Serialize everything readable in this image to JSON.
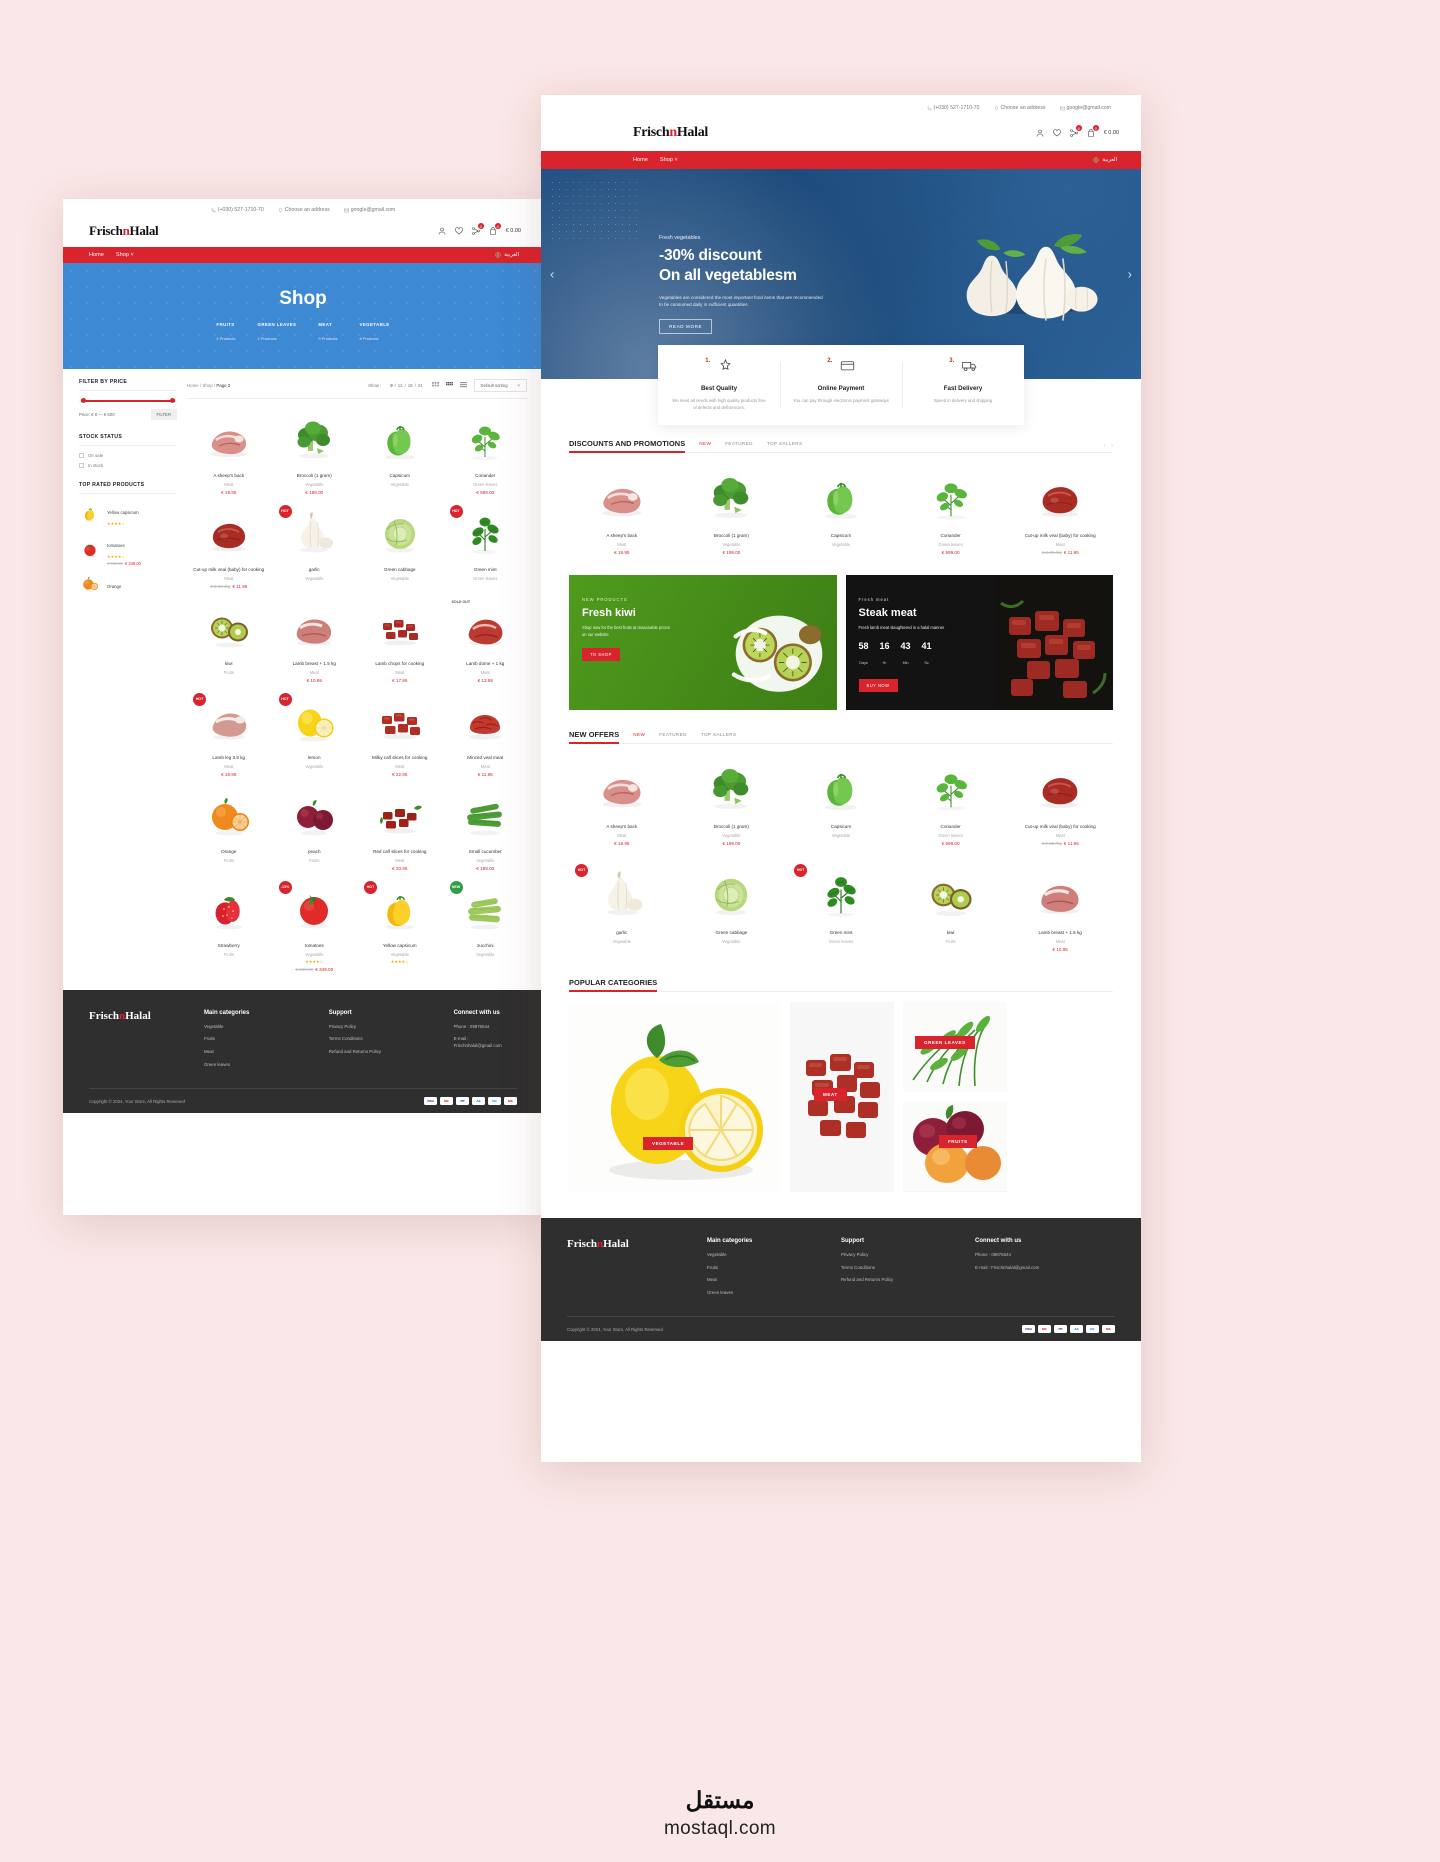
{
  "brand": {
    "part1": "Frisch",
    "accent": "n",
    "part2": "Halal"
  },
  "colors": {
    "accent": "#d9232d",
    "hero_blue": "#1e4d80",
    "shop_blue": "#3d89d4",
    "footer": "#2f2f2f"
  },
  "topbar": {
    "phone": "(+030) 527-1710-70",
    "address": "Choose an address",
    "email": "google@gmail.com"
  },
  "header": {
    "cart_total": "€ 0.00",
    "wishlist_count": "0",
    "cart_count": "0",
    "compare_count": "0"
  },
  "nav": {
    "home": "Home",
    "shop": "Shop",
    "lang": "العربية"
  },
  "hero": {
    "eyebrow": "Fresh vegetables",
    "line1": "-30% discount",
    "line2": "On all vegetablesm",
    "sub": "Vegetables are considered the most important food items that are recommended to be consumed daily in sufficient quantities",
    "cta": "READ MORE"
  },
  "features": [
    {
      "num": "1.",
      "icon": "quality-icon",
      "title": "Best Quality",
      "text": "We meet all needs with high quality products free of defects and deficiencies."
    },
    {
      "num": "2.",
      "icon": "payment-icon",
      "title": "Online Payment",
      "text": "You can pay through electronic payment gateways"
    },
    {
      "num": "3.",
      "icon": "delivery-icon",
      "title": "Fast Delivery",
      "text": "Speed in delivery and shipping"
    }
  ],
  "sections": {
    "discounts": {
      "title": "DISCOUNTS AND PROMOTIONS",
      "tabs": [
        "NEW",
        "FEATURED",
        "TOP SALLERS"
      ],
      "active_tab": "NEW"
    },
    "newoffers": {
      "title": "NEW OFFERS",
      "tabs": [
        "NEW",
        "FEATURED",
        "TOP SALLERS"
      ],
      "active_tab": "NEW"
    },
    "popular": {
      "title": "POPULAR CATEGORIES"
    }
  },
  "products_discounts": [
    {
      "name": "A sheep's back",
      "cat": "Meat",
      "price": "€ 19.95",
      "old": "",
      "tag": "",
      "img": "lamb-ribs"
    },
    {
      "name": "Broccoli (1 gram)",
      "cat": "Vegetable",
      "price": "€ 199.00",
      "old": "",
      "tag": "",
      "img": "broccoli"
    },
    {
      "name": "Capsicum",
      "cat": "Vegetable",
      "price": "",
      "old": "",
      "tag": "",
      "img": "capsicum"
    },
    {
      "name": "Coriander",
      "cat": "Green leaves",
      "price": "€ 599.00",
      "old": "",
      "tag": "",
      "img": "coriander"
    },
    {
      "name": "Cut-up milk veal (baby) for cooking",
      "cat": "Meat",
      "price": "€ 11.95",
      "old": "€ 3.98 /kg",
      "tag": "",
      "img": "veal-steak"
    }
  ],
  "products_newoffers_row1": [
    {
      "name": "A sheep's back",
      "cat": "Meat",
      "price": "€ 19.95",
      "old": "",
      "tag": "",
      "img": "lamb-ribs"
    },
    {
      "name": "Broccoli (1 gram)",
      "cat": "Vegetable",
      "price": "€ 199.00",
      "old": "",
      "tag": "",
      "img": "broccoli"
    },
    {
      "name": "Capsicum",
      "cat": "Vegetable",
      "price": "",
      "old": "",
      "tag": "",
      "img": "capsicum"
    },
    {
      "name": "Coriander",
      "cat": "Green leaves",
      "price": "€ 599.00",
      "old": "",
      "tag": "",
      "img": "coriander"
    },
    {
      "name": "Cut-up milk veal (baby) for cooking",
      "cat": "Meat",
      "price": "€ 11.95",
      "old": "€ 3.98 /kg",
      "tag": "",
      "img": "veal-steak"
    }
  ],
  "products_newoffers_row2": [
    {
      "name": "garlic",
      "cat": "Vegetable",
      "price": "",
      "old": "",
      "tag": "HOT",
      "img": "garlic"
    },
    {
      "name": "Green cabbage",
      "cat": "Vegetable",
      "price": "",
      "old": "",
      "tag": "",
      "img": "cabbage"
    },
    {
      "name": "Green mint",
      "cat": "Green leaves",
      "price": "",
      "old": "",
      "tag": "HOT",
      "img": "mint"
    },
    {
      "name": "kiwi",
      "cat": "Fruits",
      "price": "",
      "old": "",
      "tag": "",
      "img": "kiwi"
    },
    {
      "name": "Lamb breast + 1.5 kg",
      "cat": "Meat",
      "price": "€ 10.95",
      "old": "",
      "tag": "",
      "img": "lamb-breast"
    }
  ],
  "promo_left": {
    "eyebrow": "NEW PRODUCTS",
    "title": "Fresh kiwi",
    "text": "Shop now for the best fruits at reasonable prices on our website",
    "cta": "TO SHOP"
  },
  "promo_right": {
    "eyebrow": "Fresh meat",
    "title": "Steak meat",
    "text": "Fresh lamb meat slaughtered in a halal manner",
    "countdown": [
      {
        "value": "58",
        "unit": "Days"
      },
      {
        "value": "16",
        "unit": "Hr"
      },
      {
        "value": "43",
        "unit": "Min"
      },
      {
        "value": "41",
        "unit": "Sc"
      }
    ],
    "cta": "BUY NOW"
  },
  "categories": [
    {
      "label": "VEGETABLE",
      "img": "lemons"
    },
    {
      "label": "MEAT",
      "img": "diced-meat"
    },
    {
      "label": "GREEN LEAVES",
      "img": "dill"
    },
    {
      "label": "FRUITS",
      "img": "plums-peach"
    }
  ],
  "footer": {
    "cols": [
      {
        "title": "Main categories",
        "links": [
          "Vegetable",
          "Fruits",
          "Meat",
          "Green leaves"
        ]
      },
      {
        "title": "Support",
        "links": [
          "Privacy Policy",
          "Terms Conditions",
          "Refund and Returns Policy"
        ]
      }
    ],
    "connect_title": "Connect with us",
    "phone": "Phone : 09876544",
    "email": "E-mail : Frischnhalal@gmail.com",
    "copyright": "Copyright © 2024, Your Store, All Rights Reserved",
    "payments": [
      "VISA",
      "MC",
      "PP",
      "AE",
      "DC",
      "MA"
    ]
  },
  "shop": {
    "page_title": "Shop",
    "categories": [
      {
        "name": "FRUITS",
        "count": "4 Products"
      },
      {
        "name": "GREEN LEAVES",
        "count": "2 Products"
      },
      {
        "name": "MEAT",
        "count": "9 Products"
      },
      {
        "name": "VEGETABLE",
        "count": "8 Products"
      }
    ],
    "sidebar": {
      "filter_price_title": "FILTER BY PRICE",
      "price_label": "Price: € 0 — € 600",
      "filter_button": "FILTER",
      "stock_title": "STOCK STATUS",
      "stock_options": [
        "On sale",
        "In stock"
      ],
      "top_rated_title": "TOP RATED PRODUCTS",
      "top_rated": [
        {
          "name": "Yellow capsicum",
          "stars": "★★★★☆",
          "price": "",
          "old": "",
          "img": "yellow-pepper"
        },
        {
          "name": "tomatoes",
          "stars": "★★★★☆",
          "price": "€ 349.00",
          "old": "€ 999.00",
          "img": "tomato"
        },
        {
          "name": "Orange",
          "stars": "",
          "price": "",
          "old": "",
          "img": "orange"
        }
      ]
    },
    "breadcrumb": {
      "home": "Home",
      "shop": "Shop",
      "page": "Page 2"
    },
    "show_label": "Show :",
    "show_options": [
      "9",
      "12",
      "18",
      "24"
    ],
    "show_active": "9",
    "sort_label": "Default sorting",
    "products": [
      {
        "name": "A sheep's back",
        "cat": "Meat",
        "price": "€ 19.95",
        "old": "",
        "tag": "",
        "img": "lamb-ribs"
      },
      {
        "name": "Broccoli (1 gram)",
        "cat": "Vegetable",
        "price": "€ 199.00",
        "old": "",
        "tag": "",
        "img": "broccoli"
      },
      {
        "name": "Capsicum",
        "cat": "Vegetable",
        "price": "",
        "old": "",
        "tag": "",
        "img": "capsicum"
      },
      {
        "name": "Coriander",
        "cat": "Green leaves",
        "price": "€ 599.00",
        "old": "",
        "tag": "",
        "img": "coriander"
      },
      {
        "name": "Cut-up milk veal (baby) for cooking",
        "cat": "Meat",
        "price": "€ 11.95",
        "old": "€ 3.98 /kg",
        "tag": "",
        "img": "veal-steak"
      },
      {
        "name": "garlic",
        "cat": "Vegetable",
        "price": "",
        "old": "",
        "tag": "HOT",
        "img": "garlic"
      },
      {
        "name": "Green cabbage",
        "cat": "Vegetable",
        "price": "",
        "old": "",
        "tag": "",
        "img": "cabbage"
      },
      {
        "name": "Green mint",
        "cat": "Green leaves",
        "price": "",
        "old": "",
        "tag": "HOT",
        "img": "mint"
      },
      {
        "name": "kiwi",
        "cat": "Fruits",
        "price": "",
        "old": "",
        "tag": "",
        "img": "kiwi"
      },
      {
        "name": "Lamb breast + 1.5 kg",
        "cat": "Meat",
        "price": "€ 10.95",
        "old": "",
        "tag": "",
        "img": "lamb-breast"
      },
      {
        "name": "Lamb chops for cooking",
        "cat": "Meat",
        "price": "€ 17.95",
        "old": "",
        "tag": "",
        "img": "lamb-chops"
      },
      {
        "name": "Lamb dome + 1 kg",
        "cat": "Meat",
        "price": "€ 13.95",
        "old": "",
        "tag": "SOLD OUT",
        "img": "lamb-dome"
      },
      {
        "name": "Lamb leg 3.5 kg",
        "cat": "Meat",
        "price": "€ 18.95",
        "old": "",
        "tag": "HOT",
        "img": "lamb-leg"
      },
      {
        "name": "lemon",
        "cat": "Vegetable",
        "price": "",
        "old": "",
        "tag": "HOT",
        "img": "lemon"
      },
      {
        "name": "Milky calf slices for cooking",
        "cat": "Meat",
        "price": "€ 22.95",
        "old": "",
        "tag": "",
        "img": "calf-slices"
      },
      {
        "name": "Minced veal meat",
        "cat": "Meat",
        "price": "€ 11.95",
        "old": "",
        "tag": "",
        "img": "minced-meat"
      },
      {
        "name": "Orange",
        "cat": "Fruits",
        "price": "",
        "old": "",
        "tag": "",
        "img": "orange"
      },
      {
        "name": "peach",
        "cat": "Fruits",
        "price": "",
        "old": "",
        "tag": "",
        "img": "peach"
      },
      {
        "name": "Red calf slices for cooking",
        "cat": "Meat",
        "price": "€ 20.95",
        "old": "",
        "tag": "",
        "img": "red-calf"
      },
      {
        "name": "Small cucumber",
        "cat": "Vegetable",
        "price": "€ 199.00",
        "old": "",
        "tag": "",
        "img": "cucumber"
      },
      {
        "name": "Strawberry",
        "cat": "Fruits",
        "price": "",
        "old": "",
        "tag": "",
        "img": "strawberry"
      },
      {
        "name": "tomatoes",
        "cat": "Vegetable",
        "price": "€ 349.00",
        "old": "€ 999.00",
        "tag": "-13%",
        "img": "tomato",
        "stars": "★★★★☆"
      },
      {
        "name": "Yellow capsicum",
        "cat": "Vegetable",
        "price": "",
        "old": "",
        "tag": "HOT",
        "img": "yellow-pepper",
        "stars": "★★★★☆"
      },
      {
        "name": "zucchini",
        "cat": "Vegetable",
        "price": "",
        "old": "",
        "tag": "NEW",
        "img": "zucchini"
      }
    ]
  },
  "watermark": {
    "arabic": "مستقل",
    "site": "mostaql.com"
  }
}
